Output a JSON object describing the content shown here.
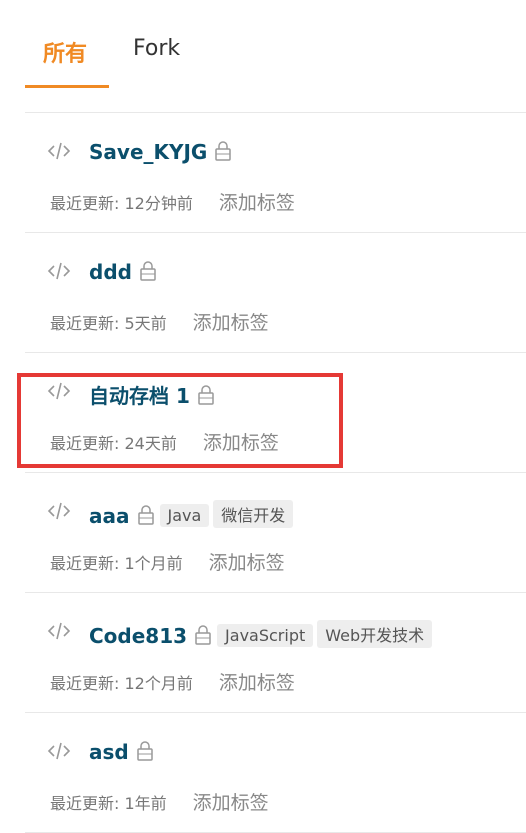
{
  "tabs": [
    {
      "label": "所有",
      "active": true
    },
    {
      "label": "Fork",
      "active": false
    }
  ],
  "repos": [
    {
      "name": "Save_KYJG",
      "updated": "最近更新: 12分钟前",
      "add_tag": "添加标签",
      "tags": []
    },
    {
      "name": "ddd",
      "updated": "最近更新: 5天前",
      "add_tag": "添加标签",
      "tags": []
    },
    {
      "name": "自动存档 1",
      "updated": "最近更新: 24天前",
      "add_tag": "添加标签",
      "tags": []
    },
    {
      "name": "aaa",
      "updated": "最近更新: 1个月前",
      "add_tag": "添加标签",
      "tags": [
        "Java",
        "微信开发"
      ]
    },
    {
      "name": "Code813",
      "updated": "最近更新: 12个月前",
      "add_tag": "添加标签",
      "tags": [
        "JavaScript",
        "Web开发技术"
      ]
    },
    {
      "name": "asd",
      "updated": "最近更新: 1年前",
      "add_tag": "添加标签",
      "tags": []
    }
  ],
  "highlighted_repo_index": 2,
  "colors": {
    "accent": "#f08a24",
    "repo_name": "#0b4f6c",
    "highlight": "#e53935",
    "tag_bg": "#eeeeee"
  },
  "icons": {
    "repo": "code-icon",
    "private": "lock-icon"
  }
}
